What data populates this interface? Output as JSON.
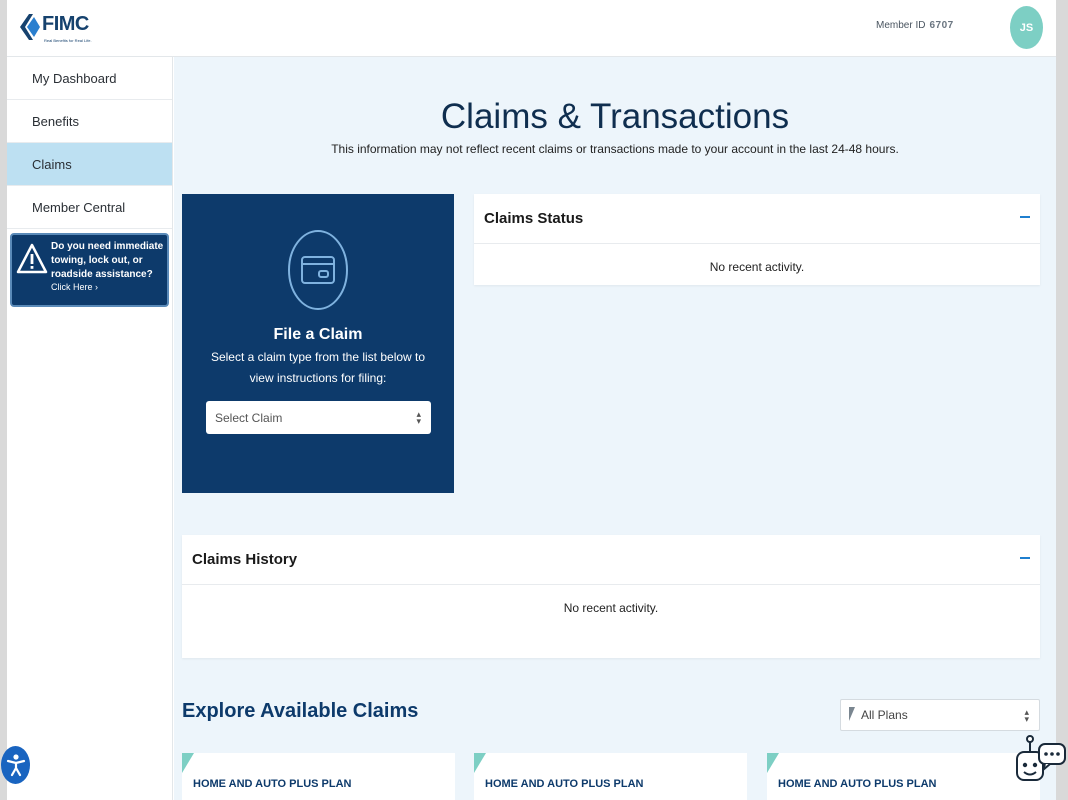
{
  "header": {
    "logo_text": "FIMC",
    "logo_tagline": "Real Benefits for Real Life.",
    "member_id_label": "Member ID",
    "member_id_value": "6707",
    "avatar_initials": "JS"
  },
  "sidebar": {
    "items": [
      {
        "label": "My Dashboard"
      },
      {
        "label": "Benefits"
      },
      {
        "label": "Claims"
      },
      {
        "label": "Member Central"
      }
    ],
    "assist": {
      "text": "Do you need immediate towing, lock out, or roadside assistance?",
      "link": "Click Here ›"
    }
  },
  "main": {
    "title": "Claims & Transactions",
    "subtitle": "This information may not reflect recent claims or transactions made to your account in the last 24-48 hours.",
    "file_claim": {
      "title": "File a Claim",
      "description": "Select a claim type from the list below to view instructions for filing:",
      "select_value": "Select Claim"
    },
    "claims_status": {
      "title": "Claims Status",
      "empty": "No recent activity."
    },
    "claims_history": {
      "title": "Claims History",
      "empty": "No recent activity."
    },
    "explore": {
      "title": "Explore Available Claims",
      "filter_value": "All Plans",
      "plans": [
        {
          "label": "HOME AND AUTO PLUS PLAN"
        },
        {
          "label": "HOME AND AUTO PLUS PLAN"
        },
        {
          "label": "HOME AND AUTO PLUS PLAN"
        }
      ]
    }
  },
  "colors": {
    "brand_navy": "#0d3a6b",
    "accent_teal": "#7dcfc4",
    "active_nav": "#bde0f2",
    "page_bg": "#edf5fb",
    "collapse_blue": "#1f7fcf"
  },
  "icons": [
    "fimc-logo-icon",
    "warning-icon",
    "credit-card-icon",
    "chevron-updown-icon",
    "minus-icon",
    "accessibility-icon",
    "chatbot-icon"
  ]
}
